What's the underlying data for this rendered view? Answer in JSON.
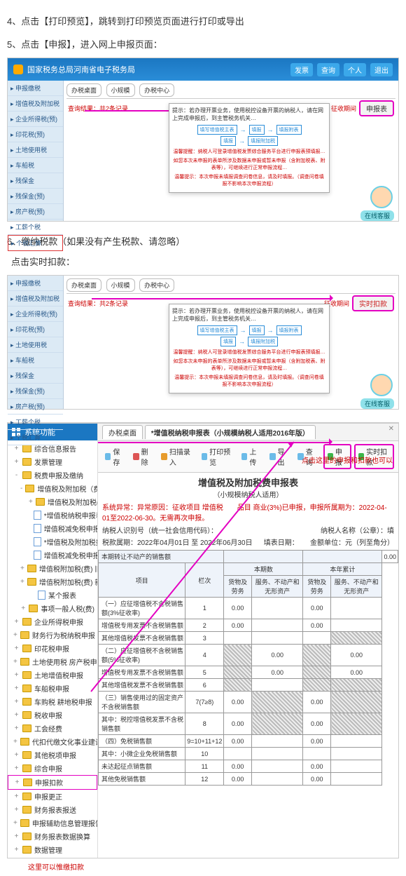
{
  "steps": {
    "s4": "4、点击【打印预览】，跳转到打印预览页面进行打印或导出",
    "s5": "5、点击【申报】，进入网上申报页面：",
    "s6": "6、缴纳税款（如果没有产生税款、请忽略）",
    "s6sub": "点击实时扣款："
  },
  "hdr": {
    "title": "国家税务总局河南省电子税务局",
    "right": [
      "发票",
      "查询",
      "个人",
      "退出"
    ]
  },
  "sidebar": {
    "items": [
      "申报缴税",
      "增值税及附加税",
      "企业所得税(预)",
      "印花税(预)",
      "土地使用税",
      "车船税",
      "残保金",
      "残保金(预)",
      "房产税(预)",
      "工薪个税",
      "个税汇算"
    ]
  },
  "dialog": {
    "note": "提示：若办理开票业务，使用税控设备开票的纳税人，请在网上完成申报后，到主管税务机关…",
    "flow": [
      "填写增值税主表",
      "填报",
      "填报附表",
      "填报附加税"
    ],
    "warn1": "温馨提醒：纳税人可登录增值税发票综合服务平台进行申报表预填报…",
    "warn2": "如您本次未申报的表单所涉及数据未申报或暂未申报（含附加税表、附表等），可继续进行正常申报流程…",
    "warn3": "温馨提示：本次申报未填报调查问卷信息，请及时填报。（调查问卷填报不影响本次申报流程）"
  },
  "shot": {
    "tabs": [
      "办税桌面",
      "小规模",
      "办税中心"
    ],
    "result": "查询结果：共2条记录",
    "col_period": "征收期间",
    "btn_open": "申报表",
    "btn_rtpay": "实时扣款",
    "chat": "在线客服"
  },
  "ts": {
    "titlebar": "系统功能",
    "tree": [
      {
        "t": "+",
        "i": "fld",
        "n": "综合信息报告",
        "d": 0
      },
      {
        "t": "+",
        "i": "fld",
        "n": "发票管理",
        "d": 0
      },
      {
        "t": "-",
        "i": "fld",
        "n": "税费申报及缴纳",
        "d": 0
      },
      {
        "t": "-",
        "i": "fld",
        "n": "增值税及附加税（费）申报",
        "d": 1
      },
      {
        "t": "+",
        "i": "fld",
        "n": "增值税及附加税(费)",
        "d": 2
      },
      {
        "t": "",
        "i": "doc",
        "n": "*增值税纳税申报表（小规",
        "d": 2
      },
      {
        "t": "",
        "i": "doc",
        "n": "增值税减免税申报（小规",
        "d": 2
      },
      {
        "t": "",
        "i": "doc",
        "n": "*增值税及附加税费申报表",
        "d": 2
      },
      {
        "t": "",
        "i": "doc",
        "n": "增值税减免税申报明细",
        "d": 2
      },
      {
        "t": "+",
        "i": "fld",
        "n": "增值税附加税(费)  旧",
        "d": 1
      },
      {
        "t": "+",
        "i": "fld",
        "n": "增值税附加税(费)  新",
        "d": 1
      },
      {
        "t": "",
        "i": "doc",
        "n": "某个报表",
        "d": 2
      },
      {
        "t": "+",
        "i": "fld",
        "n": "事项一般人税(费)",
        "d": 1
      },
      {
        "t": "+",
        "i": "fld",
        "n": "企业所得税申报",
        "d": 0
      },
      {
        "t": "+",
        "i": "fld",
        "n": "财务行为税纳税申报",
        "d": 0
      },
      {
        "t": "+",
        "i": "fld",
        "n": "印花税申报",
        "d": 0
      },
      {
        "t": "+",
        "i": "fld",
        "n": "土地使用税 房产税申报",
        "d": 0
      },
      {
        "t": "+",
        "i": "fld",
        "n": "土地增值税申报",
        "d": 0
      },
      {
        "t": "+",
        "i": "fld",
        "n": "车船税申报",
        "d": 0
      },
      {
        "t": "+",
        "i": "fld",
        "n": "车购税 耕地税申报",
        "d": 0
      },
      {
        "t": "+",
        "i": "fld",
        "n": "税收申报",
        "d": 0
      },
      {
        "t": "+",
        "i": "fld",
        "n": "工会经费",
        "d": 0
      },
      {
        "t": "+",
        "i": "fld",
        "n": "代扣代缴文化事业建设费",
        "d": 0
      },
      {
        "t": "+",
        "i": "fld",
        "n": "其他税项申报",
        "d": 0
      },
      {
        "t": "+",
        "i": "fld",
        "n": "综合申报",
        "d": 0
      },
      {
        "t": "+",
        "i": "fld",
        "n": "申报扣款",
        "d": 0,
        "sel": true
      },
      {
        "t": "+",
        "i": "fld",
        "n": "申报更正",
        "d": 0
      },
      {
        "t": "+",
        "i": "fld",
        "n": "财务报表报送",
        "d": 0
      },
      {
        "t": "+",
        "i": "fld",
        "n": "申报辅助信息管理报告",
        "d": 0
      },
      {
        "t": "+",
        "i": "fld",
        "n": "财务报表数据换算",
        "d": 0
      },
      {
        "t": "+",
        "i": "fld",
        "n": "数据管理",
        "d": 0
      }
    ],
    "tabs": [
      "办税桌面",
      "*增值税纳税申报表（小规模纳税人适用2016年版）"
    ],
    "toolbar": [
      {
        "k": "c-save",
        "t": "保存"
      },
      {
        "k": "c-del",
        "t": "删除"
      },
      {
        "k": "c-scan",
        "t": "扫描录入"
      },
      {
        "k": "c-prv",
        "t": "打印预览"
      },
      {
        "k": "c-up",
        "t": "上传"
      },
      {
        "k": "c-ex",
        "t": "导出"
      },
      {
        "k": "c-qry",
        "t": "查询"
      },
      {
        "k": "c-ok",
        "t": "申报",
        "box": true
      },
      {
        "k": "c-ok2",
        "t": "实时扣款",
        "box": true
      }
    ],
    "form_title": "增值税及附加税费申报表",
    "form_sub": "（小规模纳税人适用）",
    "warn": "系统异常：异常原因：征收项目 增值税　　品目 商业(3%)已申报，申报所属期为：2022-04-01至2022-06-30。无需再次申报。",
    "row_taxno": "纳税人识别号（统一社会信用代码）：",
    "row_taxname": "纳税人名称（公章）：填",
    "row_period": "税款属期：2022年04月01日  至  2022年06月30日",
    "row_fill": "填表日期：",
    "row_unit": "金额单位：元（列至角分）",
    "note_rt": "点击这里的申报和扣款也可以",
    "thead": {
      "blank": "本期转让不动产的销售额",
      "item": "项目",
      "col": "栏次",
      "curr": "本期数",
      "year": "本年累计",
      "sub1": "货物及劳务",
      "sub2": "服务、不动产和无形资产"
    },
    "rows": [
      {
        "name": "（一）应征增值税不含税销售额(3%征收率)",
        "col": "1",
        "v": [
          "0.00",
          "",
          "0.00",
          ""
        ]
      },
      {
        "name": "   增值税专用发票不含税销售额",
        "col": "2",
        "v": [
          "0.00",
          "",
          "0.00",
          ""
        ]
      },
      {
        "name": "   其他增值税发票不含税销售额",
        "col": "3",
        "v": [
          "",
          "",
          "",
          ""
        ],
        "diag": [
          3
        ]
      },
      {
        "name": "（二）应征增值税不含税销售额(5%征收率)",
        "col": "4",
        "v": [
          "",
          "0.00",
          "",
          "0.00"
        ],
        "diag": [
          0,
          2
        ]
      },
      {
        "name": "   增值税专用发票不含税销售额",
        "col": "5",
        "v": [
          "",
          "0.00",
          "",
          "0.00"
        ],
        "diag": [
          0,
          2
        ]
      },
      {
        "name": "   其他增值税发票不含税销售额",
        "col": "6",
        "v": [
          "",
          "",
          "",
          ""
        ],
        "diag": [
          0,
          2,
          3
        ]
      },
      {
        "name": "（三）销售使用过的固定资产不含税销售额",
        "col": "7(7≥8)",
        "v": [
          "0.00",
          "",
          "0.00",
          ""
        ],
        "diag": [
          1,
          3
        ]
      },
      {
        "name": "   其中：税控增值税发票不含税销售额",
        "col": "8",
        "v": [
          "0.00",
          "",
          "0.00",
          ""
        ],
        "diag": [
          1,
          3
        ]
      },
      {
        "name": "（四）免税销售额",
        "col": "9=10+11+12",
        "v": [
          "0.00",
          "",
          "0.00",
          ""
        ]
      },
      {
        "name": "   其中：小微企业免税销售额",
        "col": "10",
        "v": [
          "",
          "",
          "",
          ""
        ]
      },
      {
        "name": "   未达起征点销售额",
        "col": "11",
        "v": [
          "0.00",
          "",
          "0.00",
          ""
        ]
      },
      {
        "name": "   其他免税销售额",
        "col": "12",
        "v": [
          "0.00",
          "",
          "0.00",
          ""
        ]
      }
    ],
    "bottom_red": "这里可以惟缴扣款"
  }
}
